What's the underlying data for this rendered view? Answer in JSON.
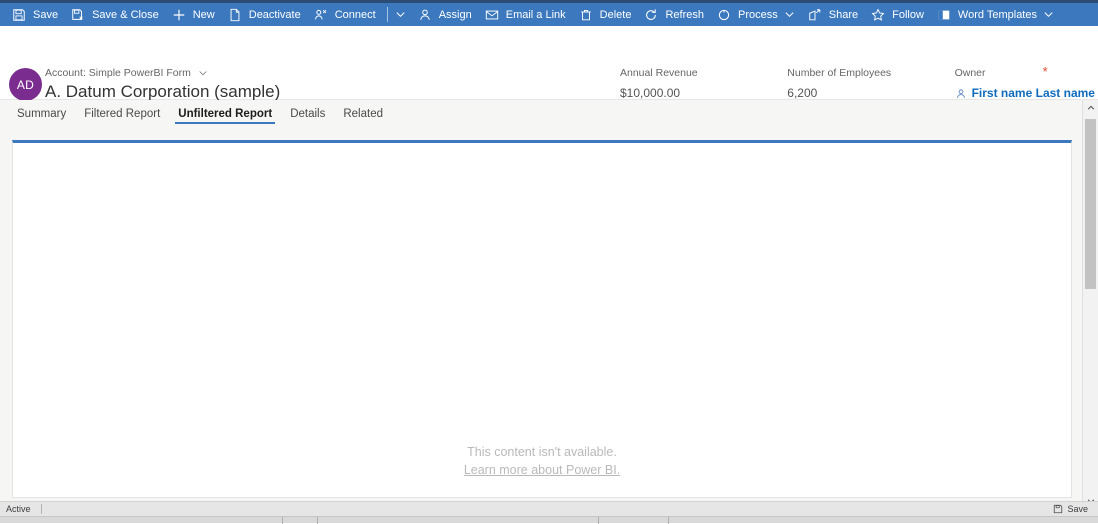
{
  "command_bar": {
    "background": "#3b78bd",
    "items": [
      {
        "icon": "save-icon",
        "label": "Save",
        "chevron": false
      },
      {
        "icon": "save-close-icon",
        "label": "Save & Close",
        "chevron": false
      },
      {
        "icon": "plus-icon",
        "label": "New",
        "chevron": false
      },
      {
        "icon": "deactivate-icon",
        "label": "Deactivate",
        "chevron": false
      },
      {
        "icon": "connect-icon",
        "label": "Connect",
        "chevron": false,
        "split": true
      },
      {
        "icon": "assign-icon",
        "label": "Assign",
        "chevron": false
      },
      {
        "icon": "email-link-icon",
        "label": "Email a Link",
        "chevron": false
      },
      {
        "icon": "delete-icon",
        "label": "Delete",
        "chevron": false
      },
      {
        "icon": "refresh-icon",
        "label": "Refresh",
        "chevron": false
      },
      {
        "icon": "process-icon",
        "label": "Process",
        "chevron": true
      },
      {
        "icon": "share-icon",
        "label": "Share",
        "chevron": false
      },
      {
        "icon": "follow-icon",
        "label": "Follow",
        "chevron": false
      },
      {
        "icon": "word-templates-icon",
        "label": "Word Templates",
        "chevron": true
      }
    ]
  },
  "record_header": {
    "avatar_initials": "AD",
    "avatar_color": "#7a2d8e",
    "entity_label": "Account: Simple PowerBI Form",
    "record_title": "A. Datum Corporation (sample)",
    "fields": [
      {
        "label": "Annual Revenue",
        "value": "$10,000.00"
      },
      {
        "label": "Number of Employees",
        "value": "6,200"
      }
    ],
    "owner": {
      "label": "Owner",
      "value": "First name Last name",
      "required_marker": "*",
      "required_color": "#e04b2a",
      "link_color": "#0f6cbd",
      "icon": "person-icon"
    }
  },
  "tabs": {
    "selected_index": 2,
    "accent": "#3b78bd",
    "items": [
      {
        "label": "Summary"
      },
      {
        "label": "Filtered Report"
      },
      {
        "label": "Unfiltered Report"
      },
      {
        "label": "Details"
      },
      {
        "label": "Related"
      }
    ]
  },
  "content": {
    "empty_message": "This content isn't available.",
    "empty_link": "Learn more about Power BI.",
    "top_border_color": "#3b78bd"
  },
  "scrollbar": {
    "up_icon": "scroll-up-icon",
    "down_icon": "scroll-down-icon",
    "thumb": "scroll-thumb"
  },
  "status_bar": {
    "state": "Active",
    "save_label": "Save",
    "save_icon": "save-icon"
  }
}
